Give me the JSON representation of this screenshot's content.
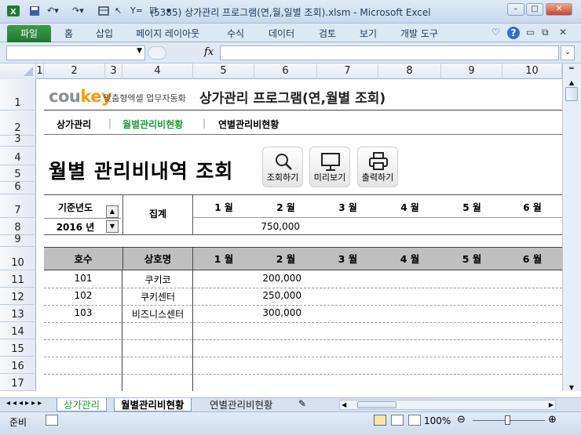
{
  "window": {
    "title": "(5385) 상가관리 프로그램(연,월,일별 조회).xlsm  -  Microsoft Excel"
  },
  "ribbon": {
    "file_tab": "파일",
    "tabs": [
      "홈",
      "삽입",
      "페이지 레이아웃",
      "수식",
      "데이터",
      "검토",
      "보기",
      "개발 도구"
    ]
  },
  "formula_bar": {
    "fx": "fx",
    "name_box": "",
    "content": ""
  },
  "columns": [
    "1",
    "2",
    "3",
    "4",
    "5",
    "6",
    "7",
    "8",
    "9",
    "10"
  ],
  "rows": [
    "1",
    "2",
    "3",
    "4",
    "5",
    "6",
    "7",
    "8",
    "9",
    "10",
    "11",
    "12",
    "13",
    "14",
    "15",
    "16",
    "17"
  ],
  "sheet": {
    "brand": "coukey",
    "brand_sub": "맞춤형엑셀 업무자동화",
    "program_title": "상가관리 프로그램(연,월별 조회)",
    "nav": [
      "상가관리",
      "월별관리비현황",
      "연별관리비현황"
    ],
    "nav_sep": "|",
    "page_title": "월별 관리비내역 조회",
    "buttons": {
      "search": "조회하기",
      "preview": "미리보기",
      "print": "출력하기"
    },
    "base_year_label": "기준년도",
    "base_year_value": "2016 년",
    "summary_label": "집계",
    "months": [
      "1 월",
      "2 월",
      "3 월",
      "4 월",
      "5 월",
      "6 월"
    ],
    "summary_values": [
      "",
      "750,000",
      "",
      "",
      "",
      ""
    ],
    "table_headers": {
      "unit": "호수",
      "store": "상호명"
    },
    "table_rows": [
      {
        "unit": "101",
        "store": "쿠키코",
        "values": [
          "",
          "200,000",
          "",
          "",
          "",
          ""
        ]
      },
      {
        "unit": "102",
        "store": "쿠키센터",
        "values": [
          "",
          "250,000",
          "",
          "",
          "",
          ""
        ]
      },
      {
        "unit": "103",
        "store": "비즈니스센터",
        "values": [
          "",
          "300,000",
          "",
          "",
          "",
          ""
        ]
      }
    ]
  },
  "sheet_tabs": [
    "상가관리",
    "월별관리비현황",
    "연별관리비현황"
  ],
  "status": {
    "ready": "준비",
    "zoom": "100%"
  },
  "colors": {
    "accent_green": "#1f9a3a",
    "header_gray": "#bfbfbf",
    "brand_orange": "#f39c12"
  }
}
